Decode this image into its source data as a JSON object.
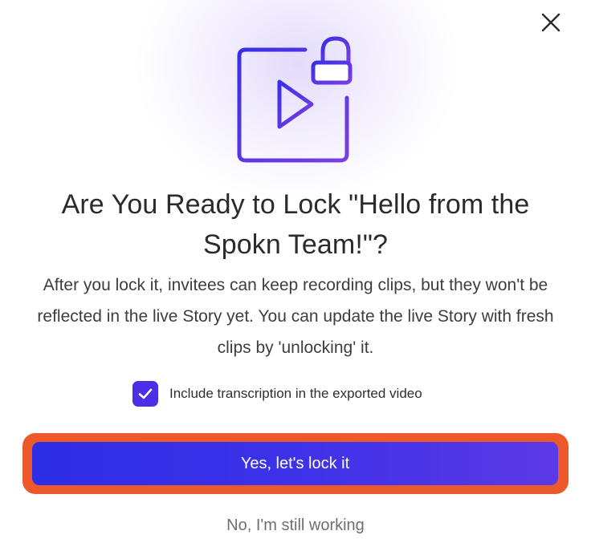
{
  "dialog": {
    "title": "Are You Ready to Lock \"Hello from the Spokn Team!\"?",
    "description": "After you lock it, invitees can keep recording clips, but they won't be reflected in the live Story yet. You can update the live Story with fresh clips by 'unlocking' it.",
    "hero_icon": "locked-video-icon",
    "close_icon": "close-icon"
  },
  "options": {
    "include_transcription": {
      "label": "Include transcription in the exported video",
      "checked": true
    }
  },
  "actions": {
    "primary_label": "Yes, let's lock it",
    "secondary_label": "No, I'm still working"
  },
  "colors": {
    "accent": "#4b2ee6",
    "button_gradient_start": "#2d2ee6",
    "button_gradient_end": "#5c39e6",
    "highlight_outline": "#ec5a2b",
    "icon_gradient_start": "#3a2fe6",
    "icon_gradient_end": "#7a3fe0"
  }
}
